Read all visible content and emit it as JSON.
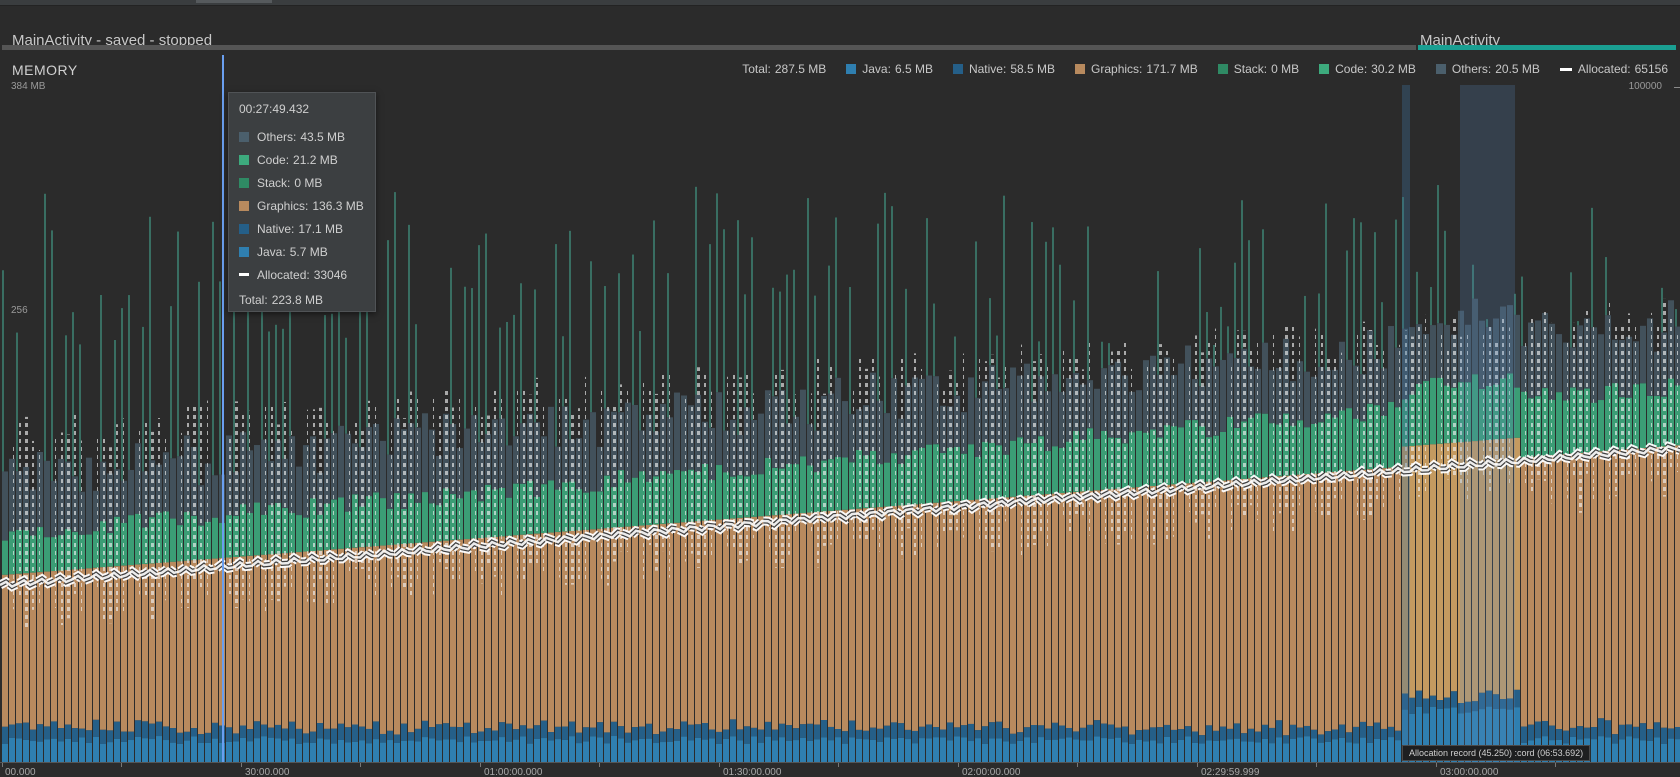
{
  "lifecycle": {
    "activities": [
      {
        "label": "MainActivity - saved - stopped",
        "color": "#555555"
      },
      {
        "label": "MainActivity",
        "color": "#1a9f92"
      }
    ]
  },
  "monitor": {
    "title": "MEMORY",
    "axis_left": {
      "max_label": "384 MB",
      "mid_label": "256"
    },
    "axis_right": {
      "max_label": "100000"
    },
    "legend": {
      "total": {
        "label": "Total:",
        "value": "287.5 MB"
      },
      "items": [
        {
          "label": "Java:",
          "value": "6.5 MB",
          "color": "#2f7fb0"
        },
        {
          "label": "Native:",
          "value": "58.5 MB",
          "color": "#255f88"
        },
        {
          "label": "Graphics:",
          "value": "171.7 MB",
          "color": "#b88a5e"
        },
        {
          "label": "Stack:",
          "value": "0 MB",
          "color": "#2f8a64"
        },
        {
          "label": "Code:",
          "value": "30.2 MB",
          "color": "#3daa7d"
        },
        {
          "label": "Others:",
          "value": "20.5 MB",
          "color": "#4b5f6c"
        }
      ],
      "allocated": {
        "label": "Allocated:",
        "value": "65156"
      }
    }
  },
  "tooltip": {
    "time": "00:27:49.432",
    "rows": [
      {
        "label": "Others:",
        "value": "43.5 MB",
        "color": "#4b5f6c"
      },
      {
        "label": "Code:",
        "value": "21.2 MB",
        "color": "#3daa7d"
      },
      {
        "label": "Stack:",
        "value": "0 MB",
        "color": "#2f8a64"
      },
      {
        "label": "Graphics:",
        "value": "136.3 MB",
        "color": "#b88a5e"
      },
      {
        "label": "Native:",
        "value": "17.1 MB",
        "color": "#255f88"
      },
      {
        "label": "Java:",
        "value": "5.7 MB",
        "color": "#2f7fb0"
      }
    ],
    "allocated": {
      "label": "Allocated:",
      "value": "33046"
    },
    "total": {
      "label": "Total:",
      "value": "223.8 MB"
    }
  },
  "x_axis": {
    "labels": [
      "00.000",
      "30:00.000",
      "01:00:00.000",
      "01:30:00.000",
      "02:00:00.000",
      "02:29:59.999",
      "03:00:00.000"
    ]
  },
  "allocation_tooltip": "Allocation record (45.250) :cord (06:53.692)"
}
